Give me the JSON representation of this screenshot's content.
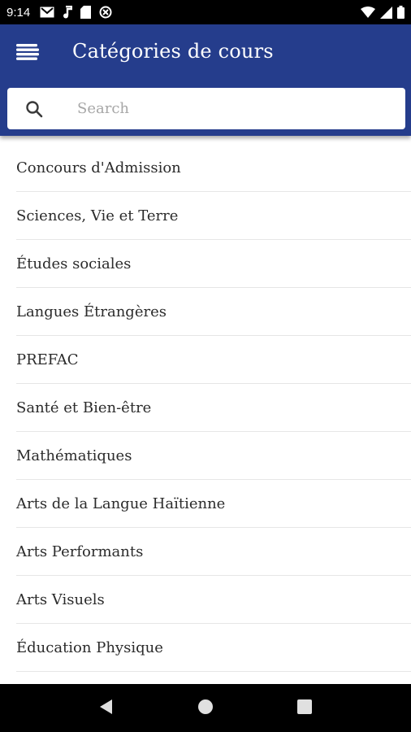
{
  "status_bar": {
    "time": "9:14",
    "left_icons": [
      "gmail-icon",
      "music-note-icon",
      "sd-card-icon",
      "data-saver-icon"
    ],
    "right_icons": [
      "wifi-icon",
      "signal-icon",
      "battery-icon"
    ]
  },
  "app_bar": {
    "title": "Catégories de cours",
    "menu_icon": "menu-icon",
    "background_color": "#253d8c"
  },
  "search": {
    "placeholder": "Search",
    "value": "",
    "icon": "search-icon"
  },
  "categories": [
    {
      "label": "Concours d'Admission"
    },
    {
      "label": "Sciences, Vie et Terre"
    },
    {
      "label": "Études sociales"
    },
    {
      "label": "Langues Étrangères"
    },
    {
      "label": "PREFAC"
    },
    {
      "label": "Santé et Bien-être"
    },
    {
      "label": "Mathématiques"
    },
    {
      "label": "Arts de la Langue Haïtienne"
    },
    {
      "label": "Arts Performants"
    },
    {
      "label": "Arts Visuels"
    },
    {
      "label": "Éducation Physique"
    }
  ],
  "nav_bar": {
    "buttons": [
      "back-icon",
      "home-icon",
      "recents-icon"
    ]
  }
}
